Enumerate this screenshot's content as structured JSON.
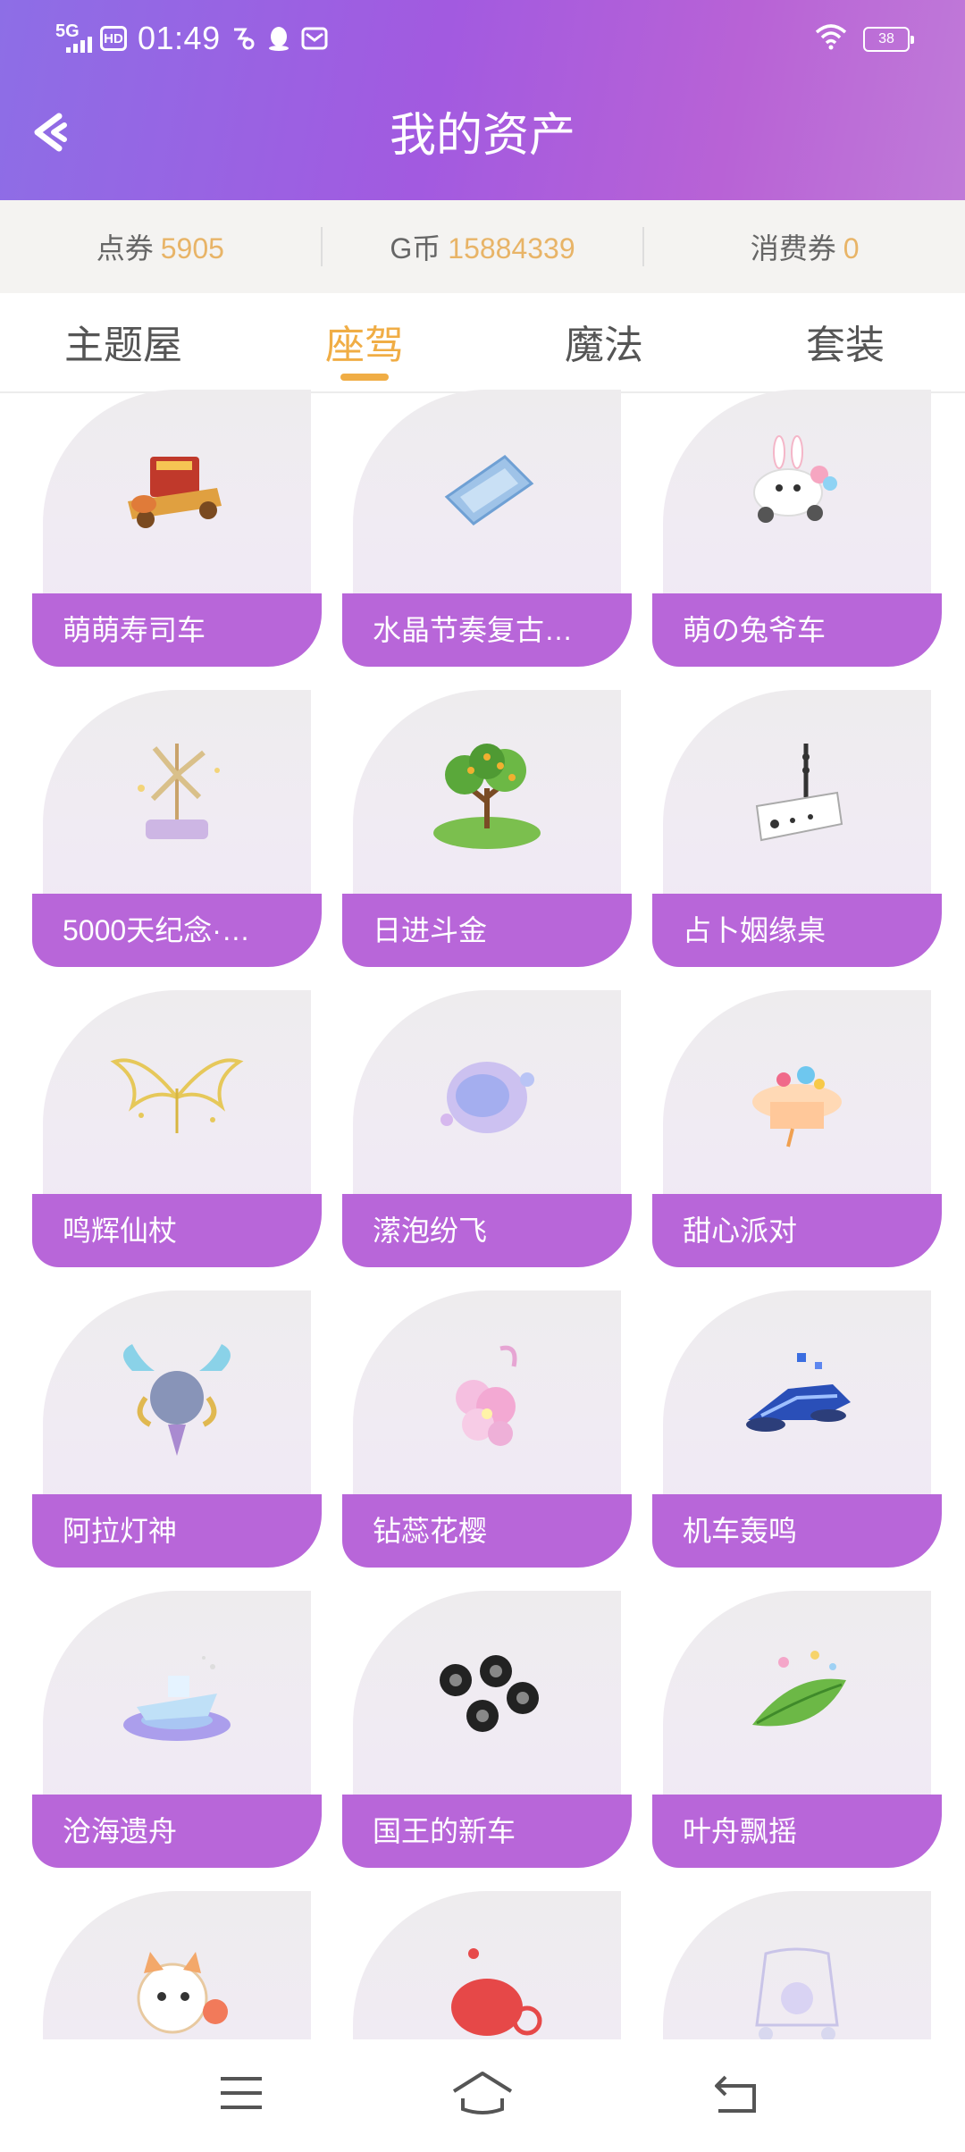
{
  "status_bar": {
    "network": "5G",
    "hd": "HD",
    "time": "01:49",
    "battery": "38",
    "icons": [
      "signal-icon",
      "hd-icon",
      "screenshot-icon",
      "qq-icon",
      "mail-icon",
      "wifi-icon",
      "battery-icon"
    ]
  },
  "header": {
    "title": "我的资产",
    "back_icon": "back-arrow-icon"
  },
  "balances": [
    {
      "label": "点券",
      "value": "5905"
    },
    {
      "label": "G币",
      "value": "15884339"
    },
    {
      "label": "消费券",
      "value": "0"
    }
  ],
  "tabs": [
    {
      "label": "主题屋",
      "active": false
    },
    {
      "label": "座驾",
      "active": true
    },
    {
      "label": "魔法",
      "active": false
    },
    {
      "label": "套装",
      "active": false
    }
  ],
  "items": [
    {
      "name": "萌萌寿司车",
      "icon": "sushi-cart-icon"
    },
    {
      "name": "水晶节奏复古…",
      "icon": "crystal-board-icon"
    },
    {
      "name": "萌の兔爷车",
      "icon": "bunny-car-icon"
    },
    {
      "name": "5000天纪念·…",
      "icon": "windmill-icon"
    },
    {
      "name": "日进斗金",
      "icon": "money-tree-icon"
    },
    {
      "name": "占卜姻缘桌",
      "icon": "fortune-table-icon"
    },
    {
      "name": "鸣辉仙杖",
      "icon": "golden-wings-icon"
    },
    {
      "name": "潆泡纷飞",
      "icon": "bubble-icon"
    },
    {
      "name": "甜心派对",
      "icon": "party-table-icon"
    },
    {
      "name": "阿拉灯神",
      "icon": "lamp-genie-icon"
    },
    {
      "name": "钻蕊花樱",
      "icon": "sakura-flower-icon"
    },
    {
      "name": "机车轰鸣",
      "icon": "motorbike-icon"
    },
    {
      "name": "沧海遗舟",
      "icon": "boat-icon"
    },
    {
      "name": "国王的新车",
      "icon": "wheels-icon"
    },
    {
      "name": "叶舟飘摇",
      "icon": "leaf-boat-icon"
    },
    {
      "name": "",
      "icon": "lucky-cat-icon"
    },
    {
      "name": "",
      "icon": "red-cart-icon"
    },
    {
      "name": "",
      "icon": "crystal-carriage-icon"
    }
  ],
  "nav_bar": {
    "icons": [
      "menu-icon",
      "home-icon",
      "back-icon"
    ]
  }
}
